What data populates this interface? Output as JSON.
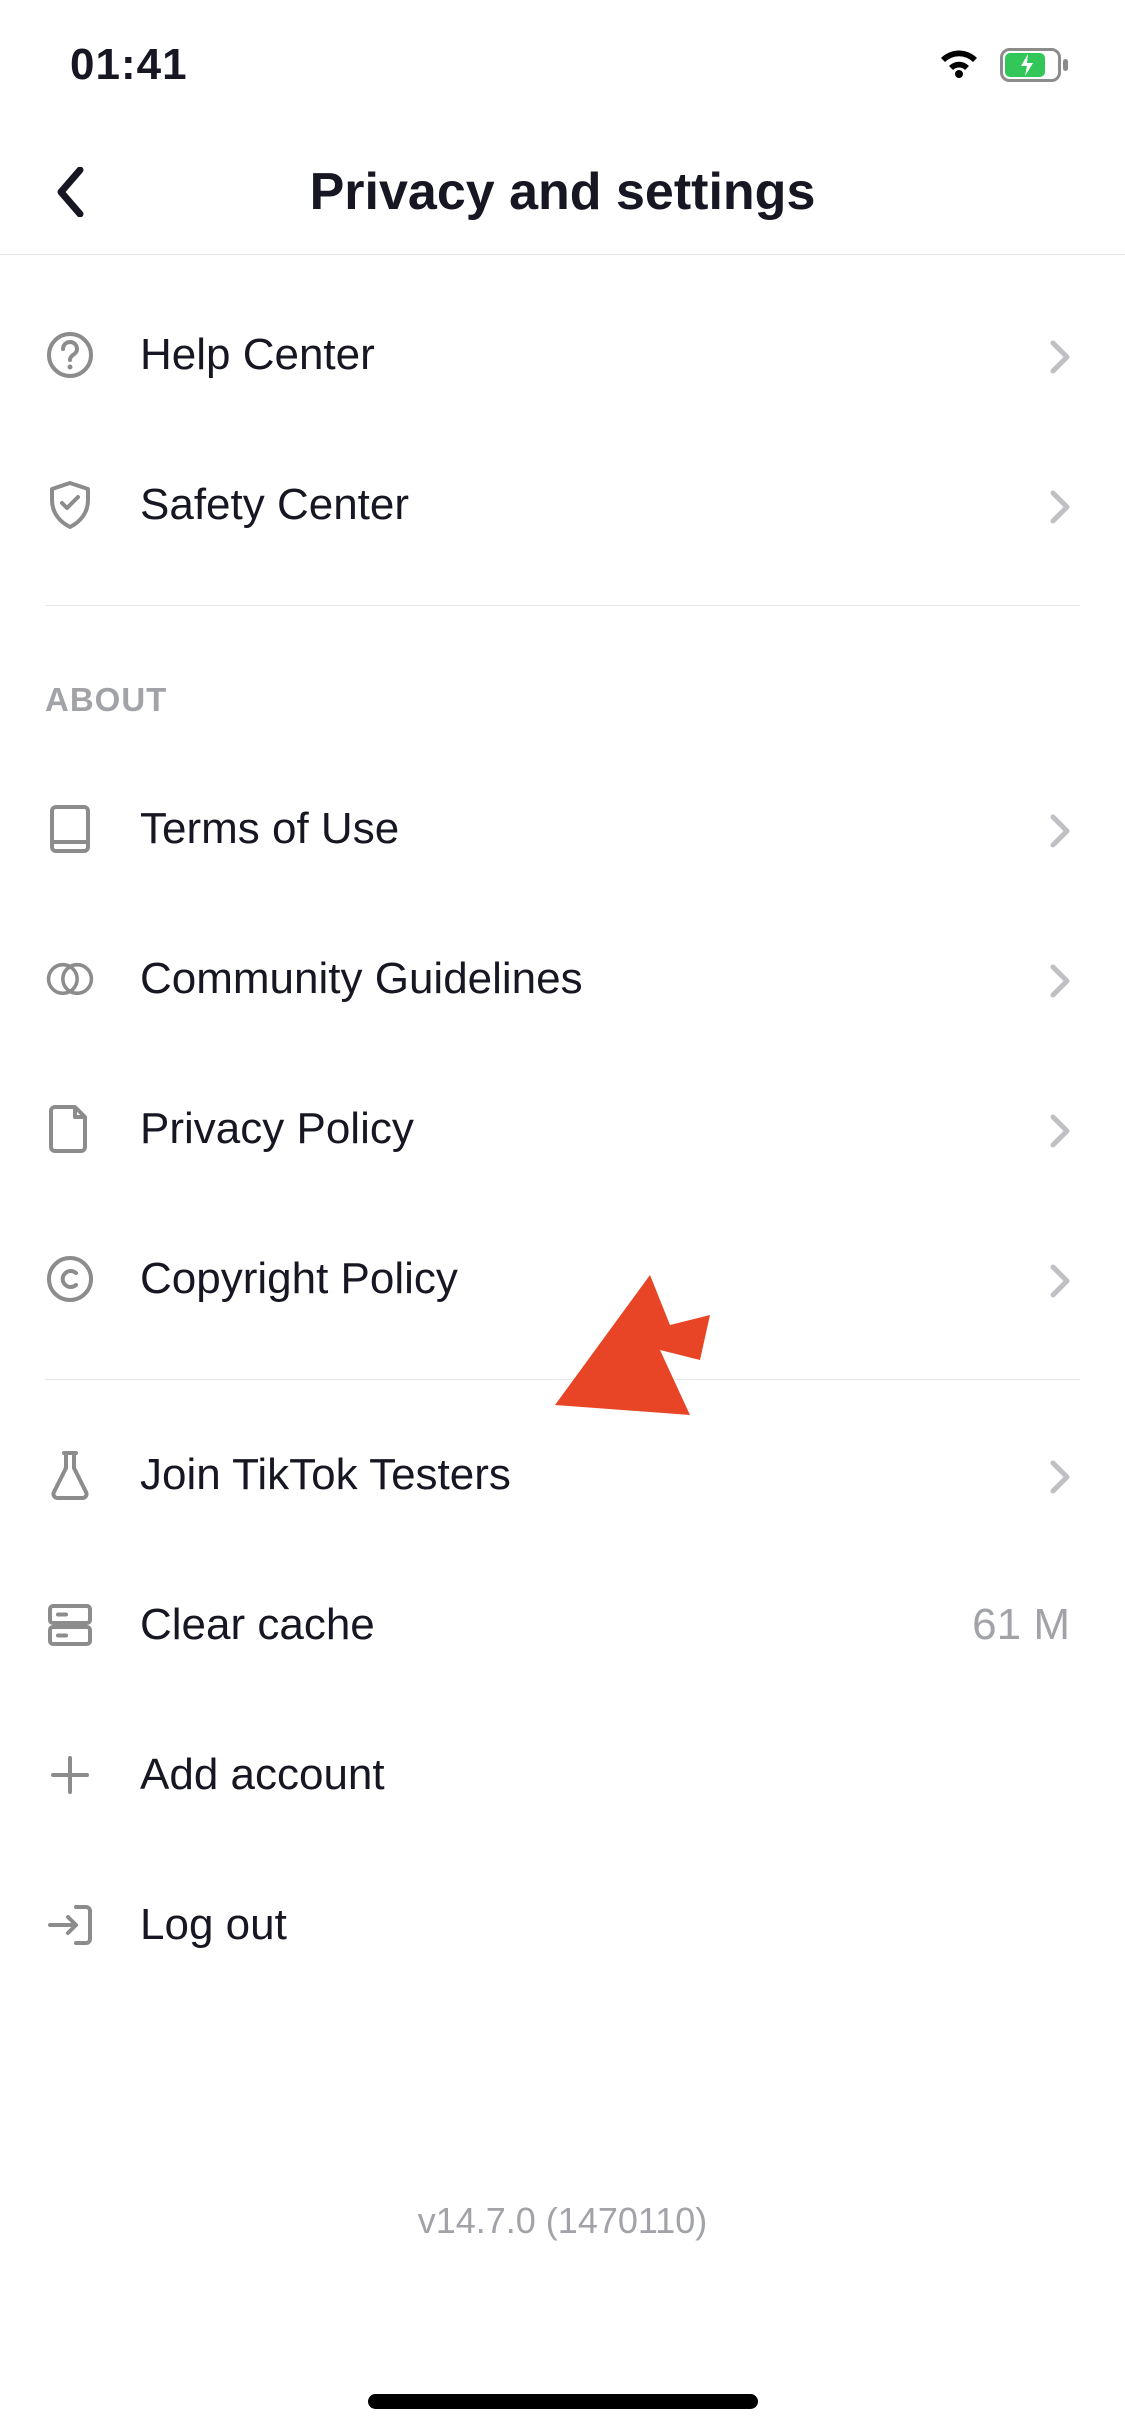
{
  "status": {
    "time": "01:41"
  },
  "header": {
    "title": "Privacy and settings"
  },
  "support": {
    "items": [
      {
        "icon": "help",
        "label": "Help Center"
      },
      {
        "icon": "shield",
        "label": "Safety Center"
      }
    ]
  },
  "about": {
    "header": "ABOUT",
    "items": [
      {
        "icon": "book",
        "label": "Terms of Use"
      },
      {
        "icon": "circles",
        "label": "Community Guidelines"
      },
      {
        "icon": "page",
        "label": "Privacy Policy"
      },
      {
        "icon": "copyright",
        "label": "Copyright Policy"
      }
    ]
  },
  "actions": {
    "items": [
      {
        "icon": "flask",
        "label": "Join TikTok Testers",
        "chevron": true
      },
      {
        "icon": "server",
        "label": "Clear cache",
        "value": "61 M"
      },
      {
        "icon": "plus",
        "label": "Add account"
      },
      {
        "icon": "logout",
        "label": "Log out"
      }
    ]
  },
  "version": "v14.7.0 (1470110)"
}
